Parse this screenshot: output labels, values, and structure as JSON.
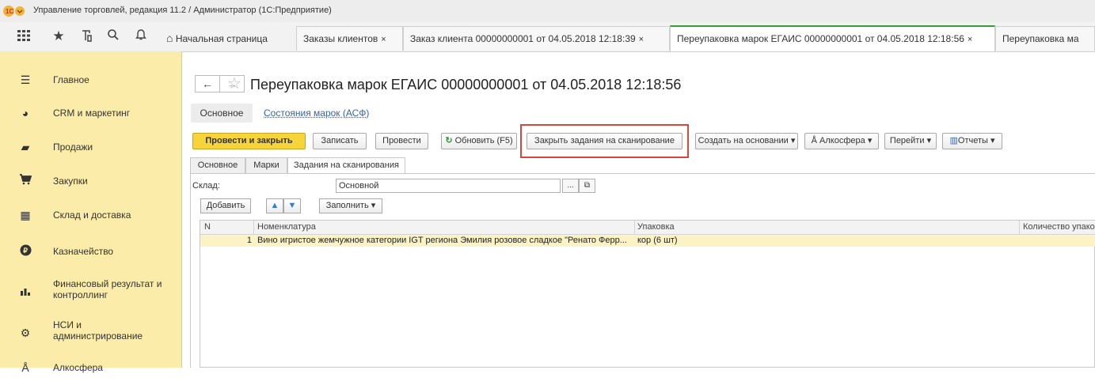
{
  "window": {
    "title": "Управление торговлей, редакция 11.2 / Администратор  (1С:Предприятие)",
    "logo_text": "1С"
  },
  "toolbar": {
    "icons": [
      "apps-grid-icon",
      "favorites-star-icon",
      "history-icon",
      "search-icon",
      "notifications-bell-icon"
    ]
  },
  "tabs": {
    "home": "Начальная страница",
    "items": [
      {
        "label": "Заказы клиентов",
        "closable": true
      },
      {
        "label": "Заказ клиента 00000000001 от 04.05.2018 12:18:39",
        "closable": true
      },
      {
        "label": "Переупаковка марок ЕГАИС 00000000001 от 04.05.2018 12:18:56",
        "closable": true,
        "active": true
      },
      {
        "label": "Переупаковка ма",
        "closable": false
      }
    ],
    "close_glyph": "×"
  },
  "sidebar": {
    "items": [
      {
        "label": "Главное",
        "icon": "menu-lines-icon"
      },
      {
        "label": "CRM и маркетинг",
        "icon": "pie-chart-icon"
      },
      {
        "label": "Продажи",
        "icon": "shopping-bag-icon"
      },
      {
        "label": "Закупки",
        "icon": "cart-icon"
      },
      {
        "label": "Склад и доставка",
        "icon": "warehouse-icon"
      },
      {
        "label": "Казначейство",
        "icon": "coin-icon"
      },
      {
        "label": "Финансовый результат и контроллинг",
        "icon": "bar-chart-icon"
      },
      {
        "label": "НСИ и администрирование",
        "icon": "gear-icon"
      },
      {
        "label": "Алкосфера",
        "icon": "alco-icon"
      }
    ]
  },
  "document": {
    "title": "Переупаковка марок ЕГАИС 00000000001 от 04.05.2018 12:18:56",
    "sections": {
      "main": "Основное",
      "link": "Состояния марок (АСФ)"
    }
  },
  "commands": {
    "post_close": "Провести и закрыть",
    "save": "Записать",
    "post": "Провести",
    "refresh": "Обновить (F5)",
    "close_scan_tasks": "Закрыть задания на сканирование",
    "create_based": "Создать на основании",
    "alcosphere": "Алкосфера",
    "goto": "Перейти",
    "reports": "Отчеты"
  },
  "form_tabs": [
    "Основное",
    "Марки",
    "Задания на сканирования"
  ],
  "form": {
    "warehouse_label": "Склад:",
    "warehouse_value": "Основной",
    "add": "Добавить",
    "fill": "Заполнить"
  },
  "table": {
    "columns": [
      "N",
      "Номенклатура",
      "Упаковка",
      "Количество упако"
    ],
    "rows": [
      {
        "n": "1",
        "item": "Вино игристое жемчужное категории IGT региона Эмилия розовое сладкое \"Ренато Ферр...",
        "pack": "кор (6 шт)",
        "qty": ""
      }
    ]
  },
  "colors": {
    "sidebar": "#fbeca9",
    "primary_button": "#f7d43a",
    "highlight": "#d9463d",
    "link": "#3465a4",
    "selected_row": "#fbf2c6"
  }
}
